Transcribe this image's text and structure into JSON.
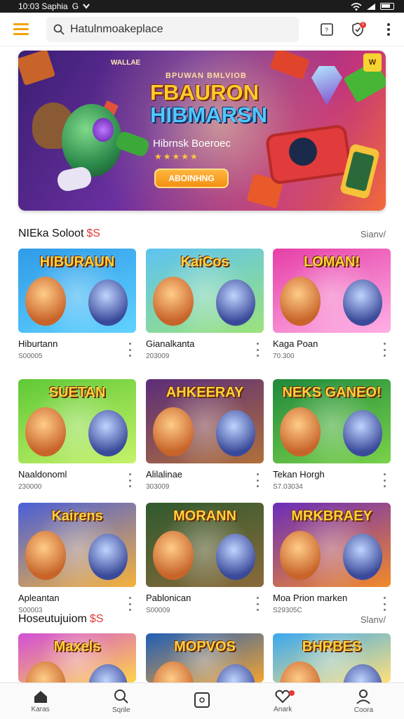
{
  "status_bar": {
    "time": "10:03 Saphia",
    "carrier": "G",
    "wifi": "wifi-icon",
    "battery": "battery-icon"
  },
  "app_bar": {
    "menu_icon": "hamburger-menu-icon",
    "search_placeholder": "Hatulnmoakeplace",
    "icons": [
      "tablet-icon",
      "shield-icon",
      "more-vert-icon"
    ],
    "shield_badge": "1"
  },
  "banner": {
    "tag": "WALLAE",
    "kicker": "BPUWAN BMLVIOB",
    "title_line1": "FBAURON",
    "title_line2": "HIBMARSN",
    "subtitle": "Hibrnsk Boeroec",
    "stars": "★★★★★",
    "button": "ABOINHNG",
    "corner_badge": "W"
  },
  "colors": {
    "accent": "#f5a10a",
    "price": "#e03b3b",
    "badge": "#e53935"
  },
  "sections": [
    {
      "title": "NIEka Soloot",
      "price": "$S",
      "see_all": "Sianv/"
    },
    {
      "title": "Hoseutujuiom",
      "price": "$S",
      "see_all": "Slanv/"
    }
  ],
  "tiles": [
    {
      "name": "Hiburtann",
      "count": "S00005",
      "label": "HIBURAUN",
      "bg": "#2f9be8",
      "bg2": "#61d2ff"
    },
    {
      "name": "Gianalkanta",
      "count": "203009",
      "label": "KaiCos",
      "bg": "#5cc3f2",
      "bg2": "#9ce37a"
    },
    {
      "name": "Kaga Poan",
      "count": "70.300",
      "label": "LOMAN!",
      "bg": "#e63fa7",
      "bg2": "#ffb0e6"
    },
    {
      "name": "Naaldonoml",
      "count": "230000",
      "label": "SUETAN",
      "bg": "#5fc936",
      "bg2": "#c6f26a"
    },
    {
      "name": "Alilalinae",
      "count": "303009",
      "label": "AHKEERAY",
      "bg": "#5b2d7a",
      "bg2": "#b0703a"
    },
    {
      "name": "Tekan Horgh",
      "count": "S7.03034",
      "label": "NEKS GANEO!",
      "bg": "#1f8a3c",
      "bg2": "#7ad24a"
    },
    {
      "name": "Apleantan",
      "count": "S00003",
      "label": "Kairens",
      "bg": "#4a5fd8",
      "bg2": "#f6b23b"
    },
    {
      "name": "Pablonican",
      "count": "S00009",
      "label": "MORANN",
      "bg": "#2f5a2e",
      "bg2": "#8a6a3a"
    },
    {
      "name": "Moa Prion marken",
      "count": "S29305C",
      "label": "MRKBRAEY",
      "bg": "#6a2dbb",
      "bg2": "#f28a2a"
    },
    {
      "name": "",
      "count": "",
      "label": "Maxels",
      "bg": "#d24fd8",
      "bg2": "#ffd44a"
    },
    {
      "name": "",
      "count": "",
      "label": "MOPVOS",
      "bg": "#1f5fb8",
      "bg2": "#f3a330"
    },
    {
      "name": "",
      "count": "",
      "label": "BHRBES",
      "bg": "#3aa8f0",
      "bg2": "#ffe07a"
    }
  ],
  "bottom_nav": [
    {
      "label": "Karas",
      "icon": "home-icon"
    },
    {
      "label": "Sqrile",
      "icon": "search-icon"
    },
    {
      "label": "",
      "icon": "tablet-icon"
    },
    {
      "label": "Anark",
      "icon": "heart-icon"
    },
    {
      "label": "Coora",
      "icon": "profile-icon"
    }
  ]
}
